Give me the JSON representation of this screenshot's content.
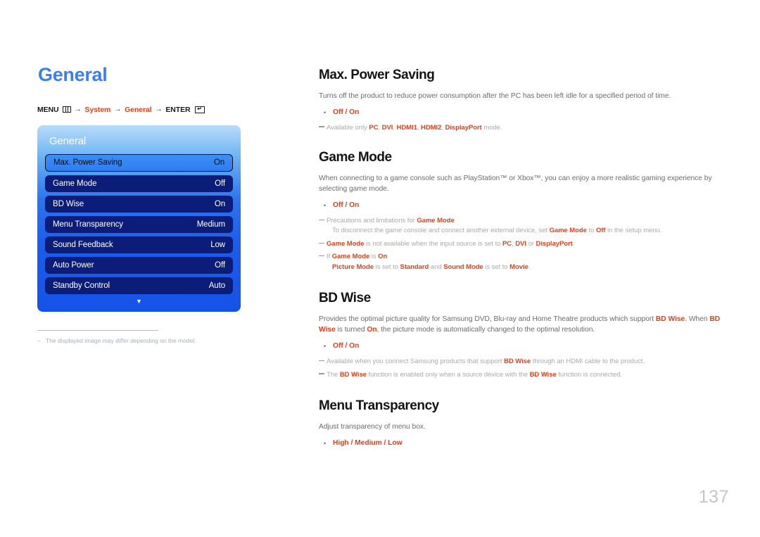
{
  "page": {
    "title": "General",
    "number": "137"
  },
  "breadcrumb": {
    "menu_label": "MENU",
    "menu_icon": "menu-grid-icon",
    "arrow": "→",
    "item1": "System",
    "item2": "General",
    "enter_label": "ENTER",
    "enter_icon": "enter-return-icon"
  },
  "osd": {
    "title": "General",
    "chevron_icon": "chevron-down-icon",
    "rows": [
      {
        "label": "Max. Power Saving",
        "value": "On",
        "selected": true
      },
      {
        "label": "Game Mode",
        "value": "Off",
        "selected": false
      },
      {
        "label": "BD Wise",
        "value": "On",
        "selected": false
      },
      {
        "label": "Menu Transparency",
        "value": "Medium",
        "selected": false
      },
      {
        "label": "Sound Feedback",
        "value": "Low",
        "selected": false
      },
      {
        "label": "Auto Power",
        "value": "Off",
        "selected": false
      },
      {
        "label": "Standby Control",
        "value": "Auto",
        "selected": false
      }
    ]
  },
  "left_footnote": {
    "dash": "–",
    "text": "The displayed image may differ depending on the model."
  },
  "sections": {
    "max_power_saving": {
      "title": "Max. Power Saving",
      "body": "Turns off the product to reduce power consumption after the PC has been left idle for a specified period of time.",
      "bullet": "Off / On",
      "note1_prefix": "Available only ",
      "note1_k1": "PC",
      "note1_mid1": ", ",
      "note1_k2": "DVI",
      "note1_mid2": ", ",
      "note1_k3": "HDMI1",
      "note1_mid3": ", ",
      "note1_k4": "HDMI2",
      "note1_mid4": ", ",
      "note1_k5": "DisplayPort",
      "note1_suffix": " mode."
    },
    "game_mode": {
      "title": "Game Mode",
      "body": "When connecting to a game console such as PlayStation™ or Xbox™, you can enjoy a more realistic gaming experience by selecting game mode.",
      "bullet": "Off / On",
      "note1_prefix": "Precautions and limitations for ",
      "note1_k1": "Game Mode",
      "note1_sub_a": "To disconnect the game console and connect another external device, set ",
      "note1_sub_k1": "Game Mode",
      "note1_sub_b": " to ",
      "note1_sub_k2": "Off",
      "note1_sub_c": " in the setup menu.",
      "note2_k1": "Game Mode",
      "note2_a": " is not available when the input source is set to ",
      "note2_k2": "PC",
      "note2_b": ", ",
      "note2_k3": "DVI",
      "note2_c": " or ",
      "note2_k4": "DisplayPort",
      "note2_d": ".",
      "note3_a": "If ",
      "note3_k1": "Game Mode",
      "note3_b": " is ",
      "note3_k2": "On",
      "note3_sub_k1": "Picture Mode",
      "note3_sub_a": " is set to ",
      "note3_sub_k2": "Standard",
      "note3_sub_b": " and ",
      "note3_sub_k3": "Sound Mode",
      "note3_sub_c": " is set to ",
      "note3_sub_k4": "Movie",
      "note3_sub_d": "."
    },
    "bd_wise": {
      "title": "BD Wise",
      "body_a": "Provides the optimal picture quality for Samsung DVD, Blu-ray and Home Theatre products which support ",
      "body_k1": "BD Wise",
      "body_b": ". When ",
      "body_k2": "BD Wise",
      "body_c": " is turned ",
      "body_k3": "On",
      "body_d": ", the picture mode is automatically changed to the optimal resolution.",
      "bullet": "Off / On",
      "note1_a": "Available when you connect Samsung products that support ",
      "note1_k1": "BD Wise",
      "note1_b": " through an HDMI cable to the product.",
      "note2_a": "The ",
      "note2_k1": "BD Wise",
      "note2_b": " function is enabled only when a source device with the ",
      "note2_k2": "BD Wise",
      "note2_c": " function is connected."
    },
    "menu_transparency": {
      "title": "Menu Transparency",
      "body": "Adjust transparency of menu box.",
      "bullet": "High / Medium / Low"
    }
  }
}
